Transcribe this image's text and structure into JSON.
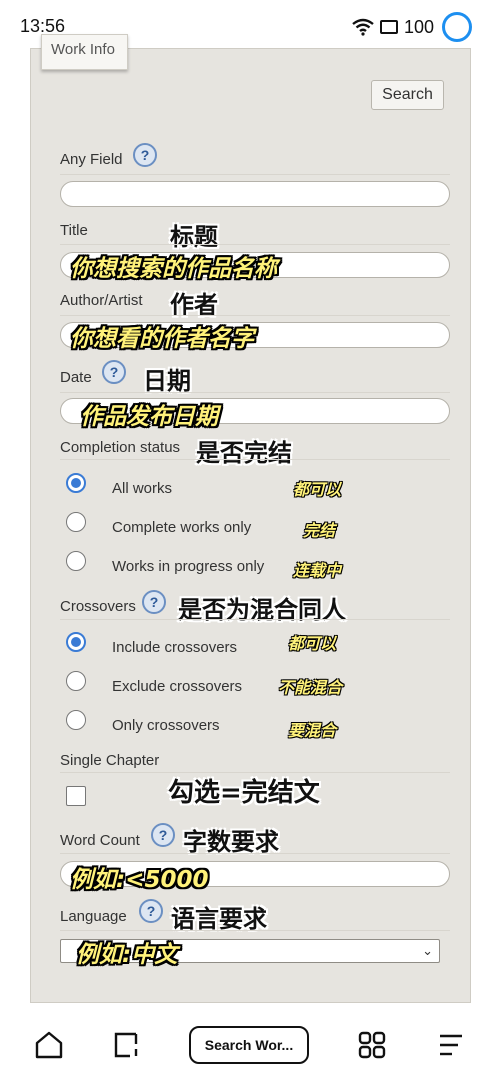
{
  "status": {
    "time": "13:56",
    "battery": "100"
  },
  "panel": {
    "tab_label": "Work Info",
    "search_button": "Search"
  },
  "fields": {
    "any_field": {
      "label": "Any Field",
      "value": ""
    },
    "title": {
      "label": "Title",
      "annotation": "标题",
      "value": "你想搜索的作品名称"
    },
    "author": {
      "label": "Author/Artist",
      "annotation": "作者",
      "value": "你想看的作者名字"
    },
    "date": {
      "label": "Date",
      "annotation": "日期",
      "value": "作品发布日期"
    },
    "word_count": {
      "label": "Word Count",
      "annotation": "字数要求",
      "value": "例如:<5000"
    },
    "language": {
      "label": "Language",
      "annotation": "语言要求",
      "value": "例如:中文"
    }
  },
  "completion": {
    "label": "Completion status",
    "annotation": "是否完结",
    "options": [
      {
        "label": "All works",
        "note": "都可以",
        "selected": true
      },
      {
        "label": "Complete works only",
        "note": "完结",
        "selected": false
      },
      {
        "label": "Works in progress only",
        "note": "连载中",
        "selected": false
      }
    ]
  },
  "crossovers": {
    "label": "Crossovers",
    "annotation": "是否为混合同人",
    "options": [
      {
        "label": "Include crossovers",
        "note": "都可以",
        "selected": true
      },
      {
        "label": "Exclude crossovers",
        "note": "不能混合",
        "selected": false
      },
      {
        "label": "Only crossovers",
        "note": "要混合",
        "selected": false
      }
    ]
  },
  "single_chapter": {
    "label": "Single Chapter",
    "annotation": "勾选=完结文",
    "checked": false
  },
  "help_glyph": "?",
  "bottom_nav": {
    "search_label": "Search Wor..."
  },
  "colors": {
    "panel": "#e6e4df",
    "accent": "#3a7bd5",
    "annotation_yellow": "#fff27a"
  }
}
